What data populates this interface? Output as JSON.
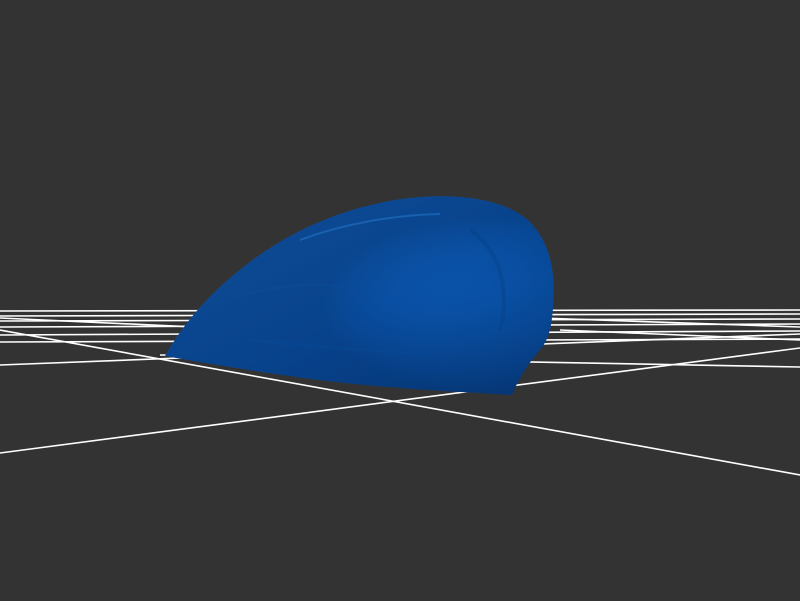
{
  "viewport": {
    "background_color": "#333333",
    "grid_color": "#ffffff",
    "model_color": "#0a59b5",
    "model_shadow_color": "#06397a",
    "model_highlight_color": "#1f73cf"
  }
}
